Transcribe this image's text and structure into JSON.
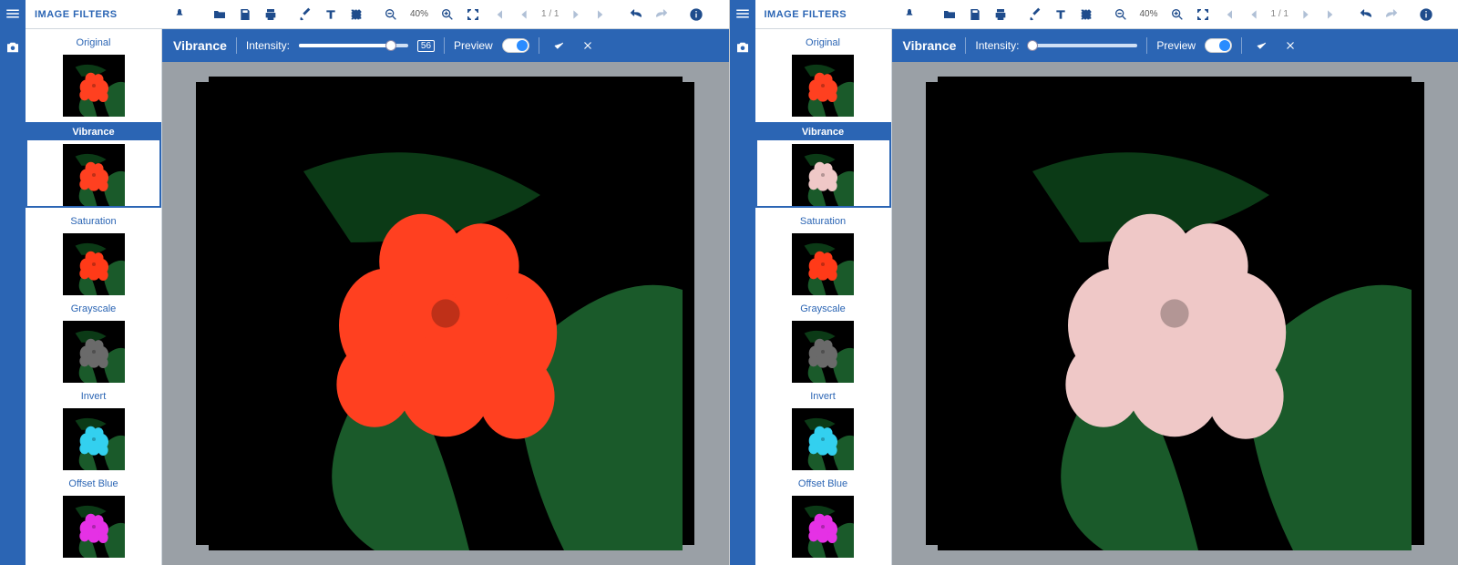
{
  "panels": [
    {
      "title": "IMAGE FILTERS",
      "zoom": "40%",
      "page": "1 / 1",
      "filter": {
        "name": "Vibrance",
        "intensity_label": "Intensity:",
        "value": 56,
        "show_value": true,
        "slider_pct": 84,
        "preview_label": "Preview"
      },
      "main_color": "#ff4020",
      "show_more": false,
      "filters": [
        {
          "label": "Original",
          "sel": false,
          "c": "#ff4020"
        },
        {
          "label": "Vibrance",
          "sel": true,
          "c": "#ff4020"
        },
        {
          "label": "Saturation",
          "sel": false,
          "c": "#ff3a18"
        },
        {
          "label": "Grayscale",
          "sel": false,
          "c": "#6a6a6a"
        },
        {
          "label": "Invert",
          "sel": false,
          "c": "#33d0ef"
        },
        {
          "label": "Offset Blue",
          "sel": false,
          "c": "#e531e5"
        }
      ]
    },
    {
      "title": "IMAGE FILTERS",
      "zoom": "40%",
      "page": "1 / 1",
      "filter": {
        "name": "Vibrance",
        "intensity_label": "Intensity:",
        "value": 0,
        "show_value": false,
        "slider_pct": 4,
        "preview_label": "Preview"
      },
      "main_color": "#efc8c7",
      "show_more": true,
      "filters": [
        {
          "label": "Original",
          "sel": false,
          "c": "#ff4020"
        },
        {
          "label": "Vibrance",
          "sel": true,
          "c": "#efc8c7"
        },
        {
          "label": "Saturation",
          "sel": false,
          "c": "#ff3a18"
        },
        {
          "label": "Grayscale",
          "sel": false,
          "c": "#6a6a6a"
        },
        {
          "label": "Invert",
          "sel": false,
          "c": "#33d0ef"
        },
        {
          "label": "Offset Blue",
          "sel": false,
          "c": "#e531e5"
        }
      ]
    }
  ],
  "icons": {
    "menu": "menu-icon",
    "camera": "camera-icon",
    "pin": "pin-icon",
    "open": "open-folder-icon",
    "save": "save-icon",
    "print": "print-icon",
    "brush": "brush-icon",
    "text": "text-icon",
    "crop": "crop-icon",
    "zoomout": "zoom-out-icon",
    "zoomin": "zoom-in-icon",
    "fit": "fit-screen-icon",
    "first": "first-page-icon",
    "prev": "prev-page-icon",
    "next": "next-page-icon",
    "last": "last-page-icon",
    "undo": "undo-icon",
    "redo": "redo-icon",
    "info": "info-icon",
    "check": "check-icon",
    "close": "close-icon",
    "more": "more-vert-icon"
  }
}
